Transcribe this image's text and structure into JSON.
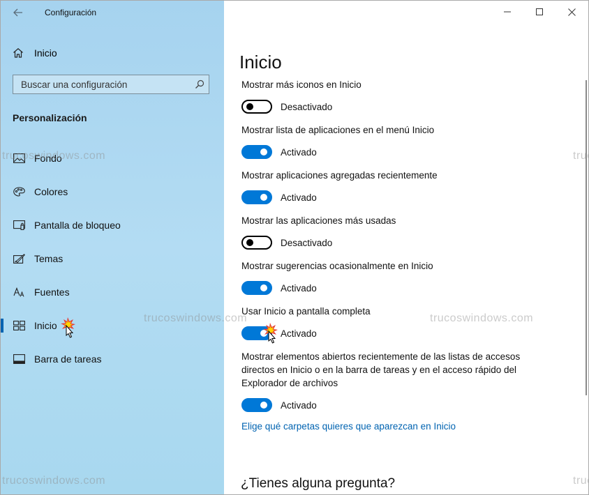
{
  "window": {
    "title": "Configuración",
    "back_icon": "back-arrow-icon",
    "controls": [
      "minimize-icon",
      "maximize-icon",
      "close-icon"
    ]
  },
  "sidebar": {
    "home_label": "Inicio",
    "search": {
      "placeholder": "Buscar una configuración",
      "icon": "search-icon"
    },
    "section_title": "Personalización",
    "items": [
      {
        "label": "Fondo",
        "icon": "picture-icon",
        "selected": false
      },
      {
        "label": "Colores",
        "icon": "palette-icon",
        "selected": false
      },
      {
        "label": "Pantalla de bloqueo",
        "icon": "lock-screen-icon",
        "selected": false
      },
      {
        "label": "Temas",
        "icon": "themes-icon",
        "selected": false
      },
      {
        "label": "Fuentes",
        "icon": "fonts-icon",
        "selected": false
      },
      {
        "label": "Inicio",
        "icon": "start-icon",
        "selected": true
      },
      {
        "label": "Barra de tareas",
        "icon": "taskbar-icon",
        "selected": false
      }
    ]
  },
  "main": {
    "page_title": "Inicio",
    "settings": [
      {
        "label": "Mostrar más iconos en Inicio",
        "on": false,
        "state": "Desactivado"
      },
      {
        "label": "Mostrar lista de aplicaciones en el menú Inicio",
        "on": true,
        "state": "Activado"
      },
      {
        "label": "Mostrar aplicaciones agregadas recientemente",
        "on": true,
        "state": "Activado"
      },
      {
        "label": "Mostrar las aplicaciones más usadas",
        "on": false,
        "state": "Desactivado"
      },
      {
        "label": "Mostrar sugerencias ocasionalmente en Inicio",
        "on": true,
        "state": "Activado"
      },
      {
        "label": "Usar Inicio a pantalla completa",
        "on": true,
        "state": "Activado"
      },
      {
        "label": "Mostrar elementos abiertos recientemente de las listas de accesos directos en Inicio o en la barra de tareas y en el acceso rápido del Explorador de archivos",
        "on": true,
        "state": "Activado"
      }
    ],
    "link": "Elige qué carpetas quieres que aparezcan en Inicio",
    "question": "¿Tienes alguna pregunta?"
  },
  "watermark": "trucoswindows.com",
  "colors": {
    "accent": "#0078d7",
    "link": "#0063b1",
    "sidebar_bg": "#a9d6f0"
  }
}
